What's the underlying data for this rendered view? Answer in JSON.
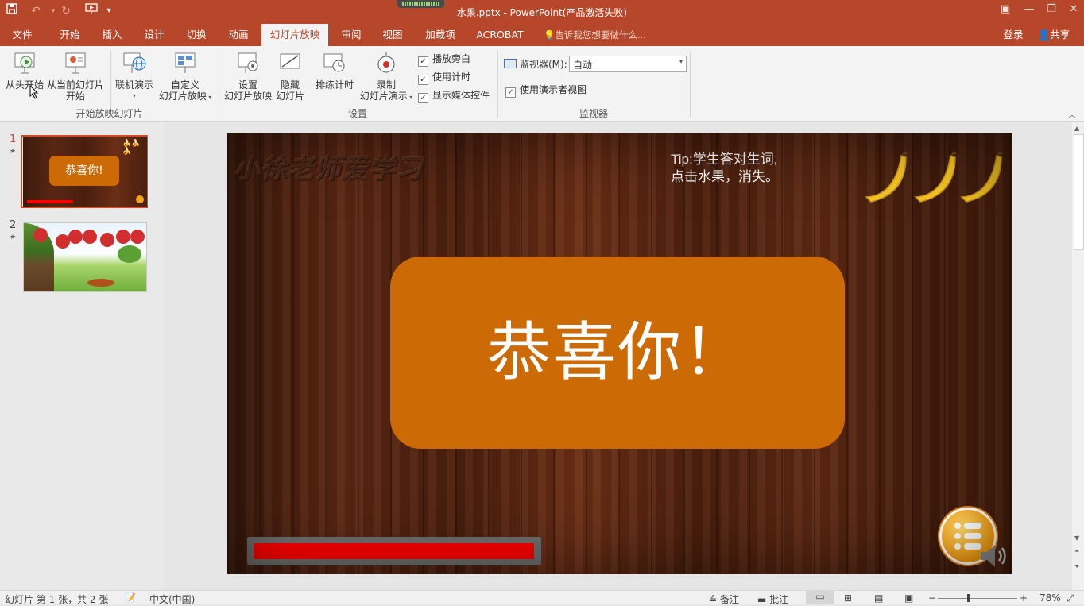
{
  "window": {
    "title": "水果.pptx - PowerPoint(产品激活失败)"
  },
  "tabs": [
    {
      "label": "文件"
    },
    {
      "label": "开始"
    },
    {
      "label": "插入"
    },
    {
      "label": "设计"
    },
    {
      "label": "切换"
    },
    {
      "label": "动画"
    },
    {
      "label": "幻灯片放映"
    },
    {
      "label": "审阅"
    },
    {
      "label": "视图"
    },
    {
      "label": "加载项"
    },
    {
      "label": "ACROBAT"
    }
  ],
  "tell_me": "告诉我您想要做什么...",
  "account": {
    "login": "登录",
    "share": "共享"
  },
  "ribbon": {
    "from_beginning": "从头开始",
    "from_current_1": "从当前幻灯片",
    "from_current_2": "开始",
    "online_present": "联机演示",
    "custom_1": "自定义",
    "custom_2": "幻灯片放映",
    "group_start": "开始放映幻灯片",
    "setup_1": "设置",
    "setup_2": "幻灯片放映",
    "hide_1": "隐藏",
    "hide_2": "幻灯片",
    "rehearse": "排练计时",
    "record_1": "录制",
    "record_2": "幻灯片演示",
    "play_narrations": "播放旁白",
    "use_timings": "使用计时",
    "show_media_controls": "显示媒体控件",
    "group_setup": "设置",
    "monitor_label": "监视器(M):",
    "monitor_value": "自动",
    "presenter_view": "使用演示者视图",
    "group_monitors": "监视器"
  },
  "thumbnails": [
    {
      "number": "1",
      "text": "恭喜你!"
    },
    {
      "number": "2"
    }
  ],
  "slide": {
    "watermark": "小徐老师爱学习",
    "tip_line1": "Tip:学生答对生词,",
    "tip_line2": "点击水果，消失。",
    "congrats": "恭喜你！",
    "progress": 1.0,
    "colors": {
      "box": "#cc6a06",
      "bar": "#ff0000",
      "theme": "#b7472a"
    }
  },
  "status": {
    "slide_info": "幻灯片 第 1 张，共 2 张",
    "language": "中文(中国)",
    "notes": "备注",
    "comments": "批注",
    "zoom": "78%"
  }
}
